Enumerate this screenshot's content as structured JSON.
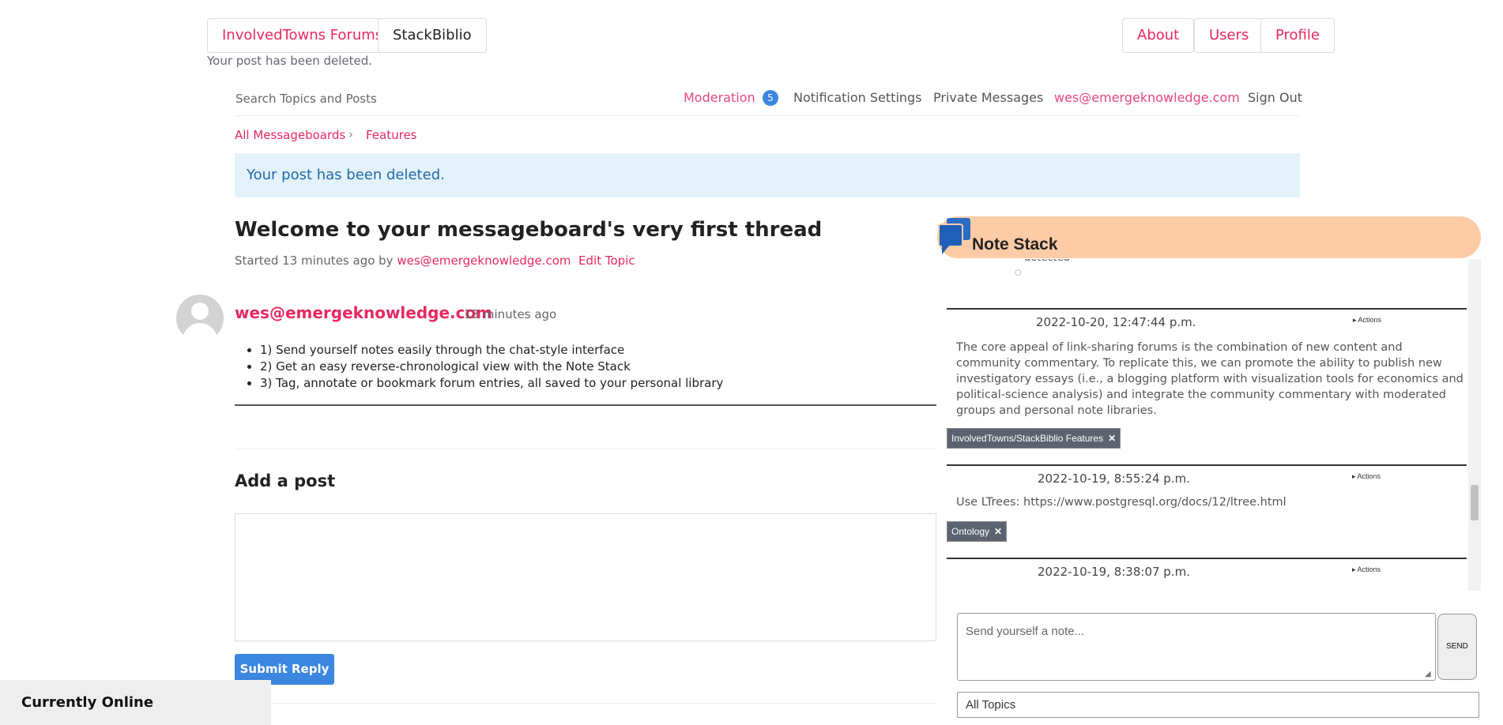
{
  "topbar": {
    "left_buttons": [
      "InvolvedTowns Forums",
      "StackBiblio"
    ],
    "right_buttons": [
      "About",
      "Users",
      "Profile"
    ],
    "flash": "Your post has been deleted."
  },
  "nav": {
    "search_placeholder": "Search Topics and Posts",
    "moderation": "Moderation",
    "moderation_count": "5",
    "notification_settings": "Notification Settings",
    "private_messages": "Private Messages",
    "user_email": "wes@emergeknowledge.com",
    "sign_out": "Sign Out"
  },
  "breadcrumb": [
    "All Messageboards",
    "Features"
  ],
  "alert": "Your post has been deleted.",
  "topic": {
    "title": "Welcome to your messageboard's very first thread",
    "started": "Started 13 minutes ago by",
    "author": "wes@emergeknowledge.com",
    "edit": "Edit Topic"
  },
  "post": {
    "author": "wes@emergeknowledge.com",
    "time": "13 minutes ago",
    "items": [
      "1) Send yourself notes easily through the chat-style interface",
      "2) Get an easy reverse-chronological view with the Note Stack",
      "3) Tag, annotate or bookmark forum entries, all saved to your personal library"
    ]
  },
  "reply": {
    "heading": "Add a post",
    "submit": "Submit Reply"
  },
  "online": "Currently Online",
  "note_stack": {
    "title": "Note Stack",
    "partial_text": "detected",
    "notes": [
      {
        "timestamp": "2022-10-20, 12:47:44 p.m.",
        "actions": "▸ Actions",
        "text": "The core appeal of link-sharing forums is the combination of new content and community commentary. To replicate this, we can promote the ability to publish new investigatory essays (i.e., a blogging platform with visualization tools for economics and political-science analysis) and integrate the community commentary with moderated groups and personal note libraries.",
        "tag": "InvolvedTowns/StackBiblio Features"
      },
      {
        "timestamp": "2022-10-19, 8:55:24 p.m.",
        "actions": "▸ Actions",
        "text": "Use LTrees: https://www.postgresql.org/docs/12/ltree.html",
        "tag": "Ontology"
      },
      {
        "timestamp": "2022-10-19, 8:38:07 p.m.",
        "actions": "▸ Actions"
      }
    ],
    "send_placeholder": "Send yourself a note...",
    "send_button": "SEND",
    "topic_select": "All Topics"
  },
  "colors": {
    "accent": "#e8285f",
    "primary_button": "#3b86e0",
    "note_header": "#fdcba5",
    "alert_bg": "#e3f1fa"
  }
}
